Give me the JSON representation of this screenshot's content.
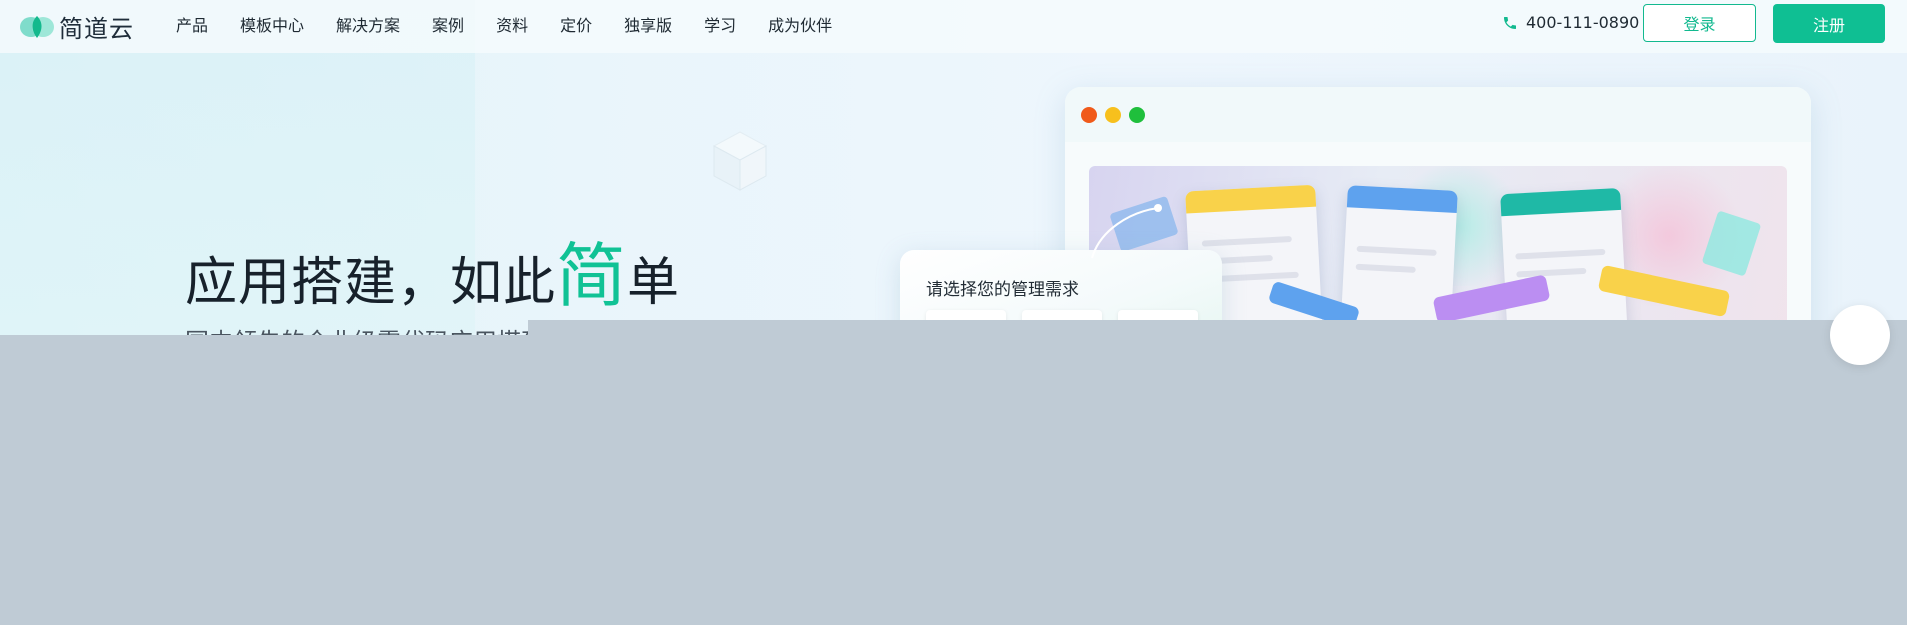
{
  "brand": {
    "name": "简道云"
  },
  "nav": {
    "items": [
      "产品",
      "模板中心",
      "解决方案",
      "案例",
      "资料",
      "定价",
      "独享版",
      "学习",
      "成为伙伴"
    ],
    "phone": "400-111-0890",
    "login": "登录",
    "signup": "注册"
  },
  "hero": {
    "title_pre": "应用搭建，如此",
    "title_highlight": "简",
    "title_post": "单",
    "subtitle": "国内领先的企业级零代码应用搭建"
  },
  "select_panel": {
    "title": "请选择您的管理需求"
  },
  "colors": {
    "accent": "#0fbf93",
    "text": "#1f2a33"
  },
  "icons": {
    "phone": "phone-icon",
    "logo": "leaf-logo-icon"
  }
}
